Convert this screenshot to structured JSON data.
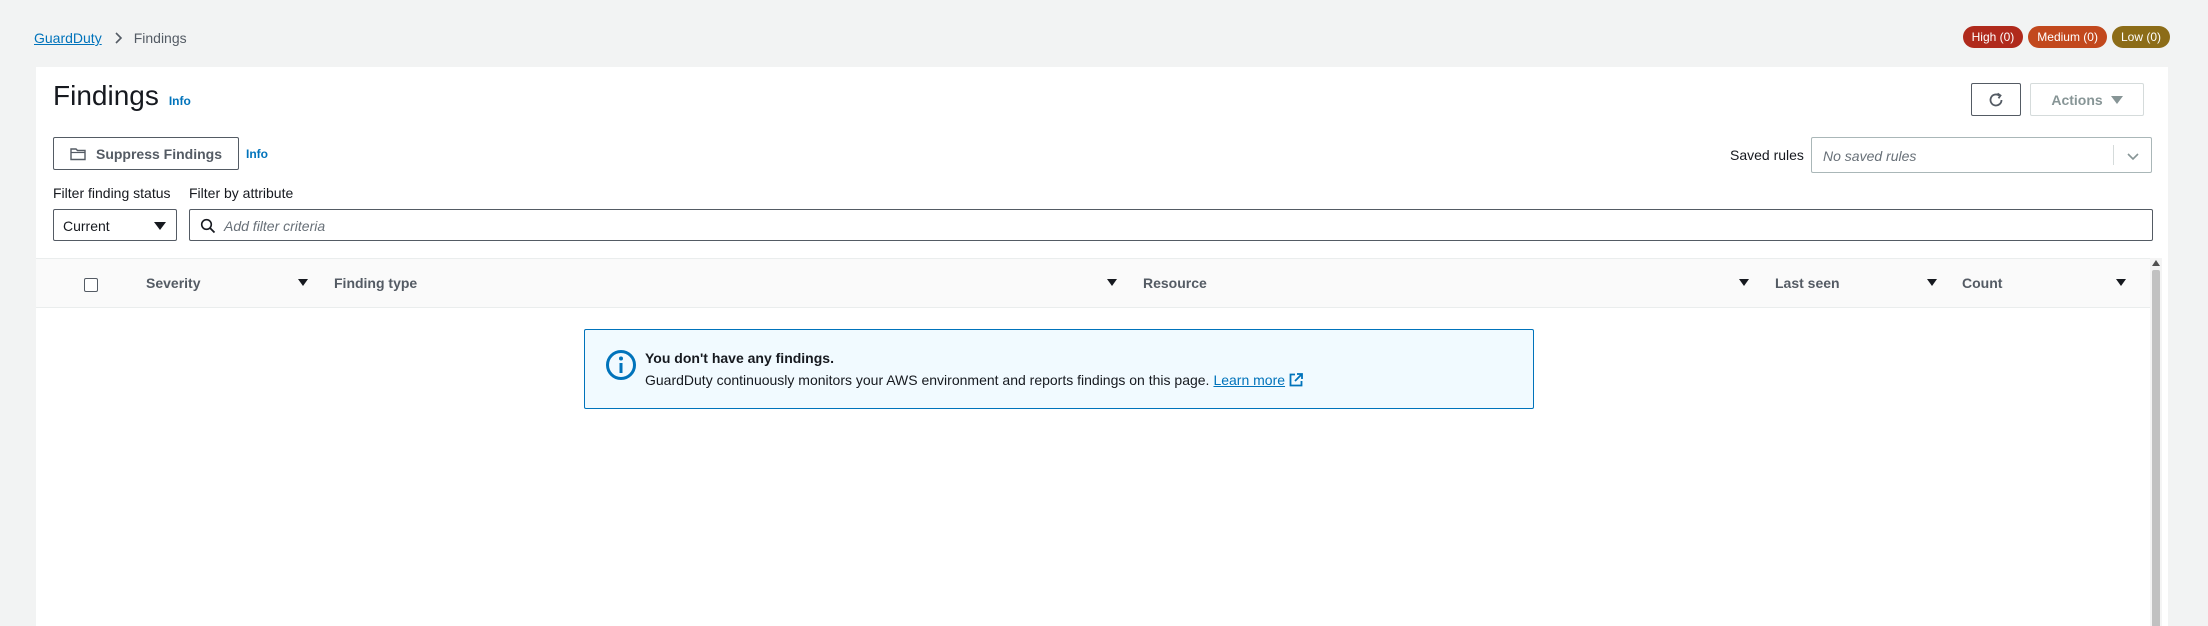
{
  "breadcrumb": {
    "root": "GuardDuty",
    "current": "Findings"
  },
  "severity_badges": {
    "high": "High (0)",
    "medium": "Medium (0)",
    "low": "Low (0)"
  },
  "header": {
    "title": "Findings",
    "info": "Info",
    "actions_label": "Actions"
  },
  "toolbar": {
    "suppress_label": "Suppress Findings",
    "suppress_info": "Info",
    "saved_rules_label": "Saved rules",
    "saved_rules_placeholder": "No saved rules"
  },
  "filters": {
    "status_label": "Filter finding status",
    "status_value": "Current",
    "attribute_label": "Filter by attribute",
    "attribute_placeholder": "Add filter criteria"
  },
  "table": {
    "columns": [
      "Severity",
      "Finding type",
      "Resource",
      "Last seen",
      "Count"
    ]
  },
  "empty_state": {
    "heading": "You don't have any findings.",
    "body": "GuardDuty continuously monitors your AWS environment and reports findings on this page.",
    "link": "Learn more"
  },
  "colors": {
    "accent": "#0073bb",
    "high": "#b02a1c",
    "medium": "#c2481d",
    "low": "#8c6c18"
  }
}
